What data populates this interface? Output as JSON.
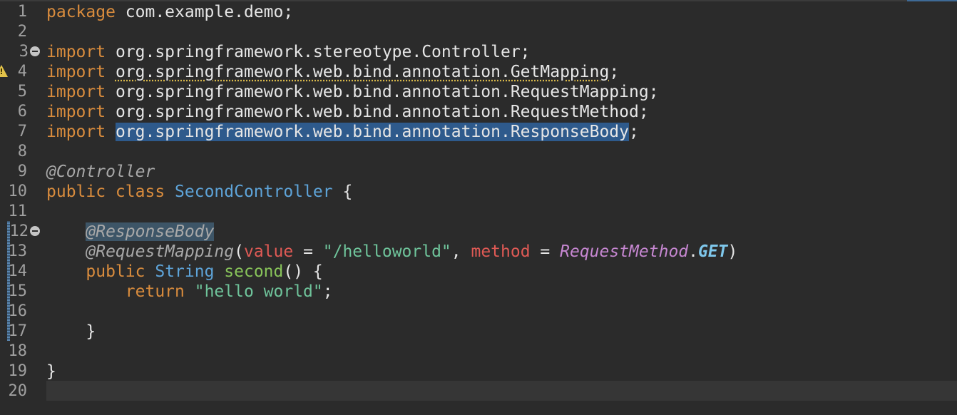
{
  "editor": {
    "language": "java",
    "lines": [
      {
        "n": "1",
        "code": [
          "package",
          " com.example.demo;"
        ]
      },
      {
        "n": "2",
        "code": []
      },
      {
        "n": "3",
        "code": [
          "import",
          " org.springframework.stereotype.Controller;"
        ]
      },
      {
        "n": "4",
        "code": [
          "import",
          " ",
          "org.springframework.web.bind.annotation.GetMapping",
          ";"
        ]
      },
      {
        "n": "5",
        "code": [
          "import",
          " org.springframework.web.bind.annotation.RequestMapping;"
        ]
      },
      {
        "n": "6",
        "code": [
          "import",
          " org.springframework.web.bind.annotation.RequestMethod;"
        ]
      },
      {
        "n": "7",
        "code": [
          "import",
          " ",
          "org.springframework.web.bind.annotation.ResponseBody",
          ";"
        ]
      },
      {
        "n": "8",
        "code": []
      },
      {
        "n": "9",
        "code": [
          "@Controller"
        ]
      },
      {
        "n": "10",
        "code": [
          "public class",
          " ",
          "SecondController",
          " {"
        ]
      },
      {
        "n": "11",
        "code": []
      },
      {
        "n": "12",
        "code": [
          "    ",
          "@ResponseBody"
        ]
      },
      {
        "n": "13",
        "code": [
          "    ",
          "@RequestMapping",
          "(",
          "value",
          " = ",
          "\"/helloworld\"",
          ", ",
          "method",
          " = ",
          "RequestMethod",
          ".",
          "GET",
          ")"
        ]
      },
      {
        "n": "14",
        "code": [
          "    ",
          "public",
          " ",
          "String",
          " ",
          "second",
          "() {"
        ]
      },
      {
        "n": "15",
        "code": [
          "        ",
          "return",
          " ",
          "\"hello world\"",
          ";"
        ]
      },
      {
        "n": "16",
        "code": []
      },
      {
        "n": "17",
        "code": [
          "    }"
        ]
      },
      {
        "n": "18",
        "code": []
      },
      {
        "n": "19",
        "code": [
          "}"
        ]
      },
      {
        "n": "20",
        "code": []
      }
    ]
  },
  "markers": {
    "warning_line": "4",
    "fold_lines": [
      "3",
      "12"
    ],
    "changed_lines": [
      "12",
      "13",
      "14",
      "15",
      "16",
      "17"
    ],
    "current_line": "20"
  },
  "colors": {
    "background": "#2b2b2b",
    "keyword": "#d98c3d",
    "annotation": "#a8a8a8",
    "class": "#5ea4d9",
    "string": "#6fc49b",
    "attribute": "#e05a55",
    "method": "#88c45a",
    "selection": "#2e5a8c"
  }
}
